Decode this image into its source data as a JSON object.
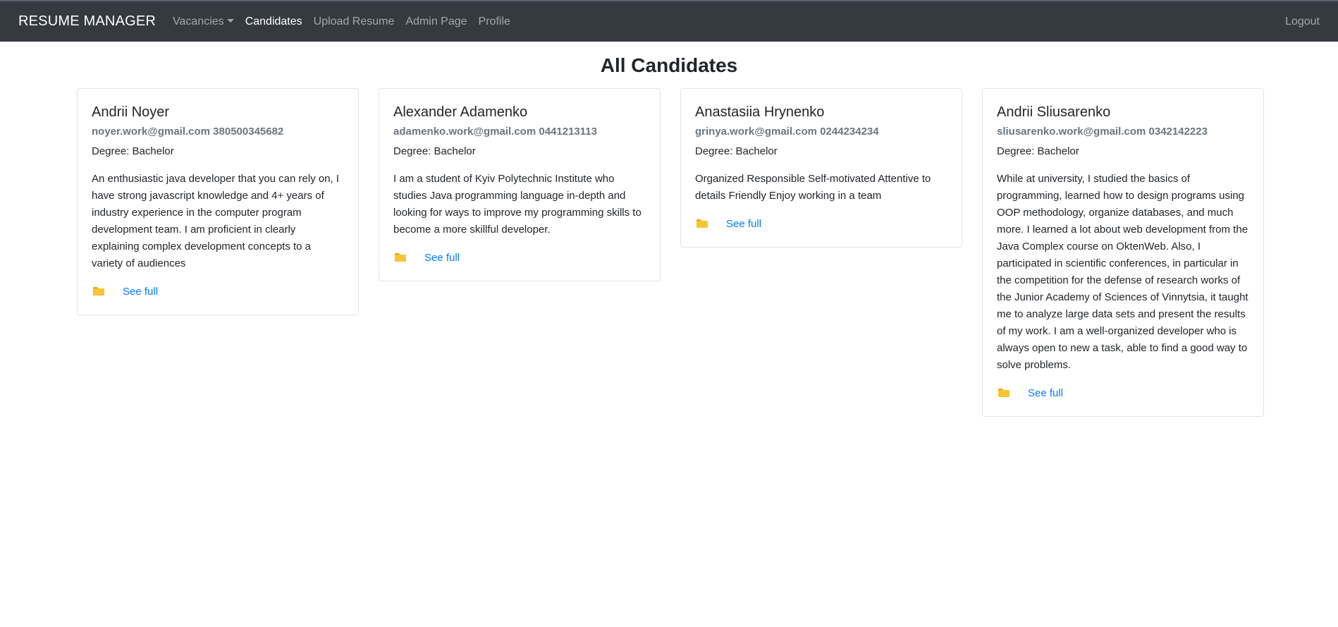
{
  "navbar": {
    "brand": "RESUME MANAGER",
    "links": [
      {
        "label": "Vacancies"
      },
      {
        "label": "Candidates"
      },
      {
        "label": "Upload Resume"
      },
      {
        "label": "Admin Page"
      },
      {
        "label": "Profile"
      }
    ],
    "logout": "Logout"
  },
  "page": {
    "title": "All Candidates"
  },
  "candidates": [
    {
      "name": "Andrii Noyer",
      "contact": "noyer.work@gmail.com 380500345682",
      "degree": "Degree: Bachelor",
      "description": "An enthusiastic java developer that you can rely on, I have strong javascript knowledge and 4+ years of industry experience in the computer program development team. I am proficient in clearly explaining complex development concepts to a variety of audiences",
      "link": "See full"
    },
    {
      "name": "Alexander Adamenko",
      "contact": "adamenko.work@gmail.com 0441213113",
      "degree": "Degree: Bachelor",
      "description": "I am a student of Kyiv Polytechnic Institute who studies Java programming language in-depth and looking for ways to improve my programming skills to become a more skillful developer.",
      "link": "See full"
    },
    {
      "name": "Anastasiia Hrynenko",
      "contact": "grinya.work@gmail.com 0244234234",
      "degree": "Degree: Bachelor",
      "description": "Organized Responsible Self-motivated Attentive to details Friendly Enjoy working in a team",
      "link": "See full"
    },
    {
      "name": "Andrii Sliusarenko",
      "contact": "sliusarenko.work@gmail.com 0342142223",
      "degree": "Degree: Bachelor",
      "description": "While at university, I studied the basics of programming, learned how to design programs using OOP methodology, organize databases, and much more. I learned a lot about web development from the Java Complex course on OktenWeb. Also, I participated in scientific conferences, in particular in the competition for the defense of research works of the Junior Academy of Sciences of Vinnytsia, it taught me to analyze large data sets and present the results of my work. I am a well-organized developer who is always open to new a task, able to find a good way to solve problems.",
      "link": "See full"
    }
  ],
  "colors": {
    "navbar_bg": "#343a40",
    "link": "#007bff",
    "muted": "#6c757d",
    "folder": "#f7c531"
  },
  "icons": {
    "folder": "folder-icon",
    "caret": "caret-down-icon"
  }
}
